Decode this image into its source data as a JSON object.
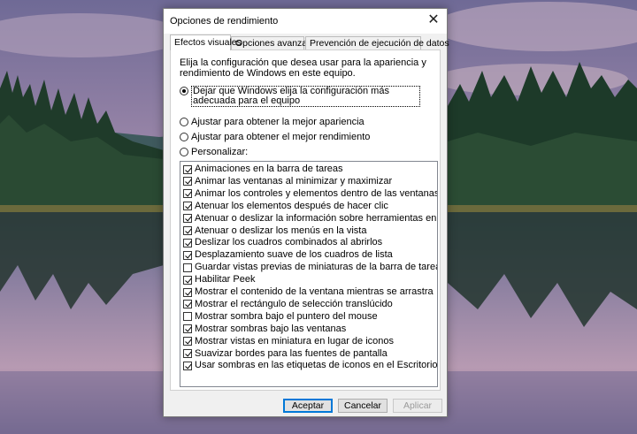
{
  "dialog": {
    "title": "Opciones de rendimiento",
    "close_glyph": "✕",
    "tabs": [
      {
        "label": "Efectos visuales",
        "active": true
      },
      {
        "label": "Opciones avanzadas",
        "active": false
      },
      {
        "label": "Prevención de ejecución de datos",
        "active": false
      }
    ],
    "description": "Elija la configuración que desea usar para la apariencia y rendimiento de Windows en este equipo.",
    "radios": {
      "default": {
        "label": "Dejar que Windows elija la configuración más adecuada para el equipo",
        "checked": true
      },
      "best_appearance": {
        "label": "Ajustar para obtener la mejor apariencia",
        "checked": false
      },
      "best_performance": {
        "label": "Ajustar para obtener el mejor rendimiento",
        "checked": false
      },
      "custom": {
        "label": "Personalizar:",
        "checked": false
      }
    },
    "effects": [
      {
        "label": "Animaciones en la barra de tareas",
        "checked": true
      },
      {
        "label": "Animar las ventanas al minimizar y maximizar",
        "checked": true
      },
      {
        "label": "Animar los controles y elementos dentro de las ventanas",
        "checked": true
      },
      {
        "label": "Atenuar los elementos después de hacer clic",
        "checked": true
      },
      {
        "label": "Atenuar o deslizar la información sobre herramientas en la vista",
        "checked": true
      },
      {
        "label": "Atenuar o deslizar los menús en la vista",
        "checked": true
      },
      {
        "label": "Deslizar los cuadros combinados al abrirlos",
        "checked": true
      },
      {
        "label": "Desplazamiento suave de los cuadros de lista",
        "checked": true
      },
      {
        "label": "Guardar vistas previas de miniaturas de la barra de tareas",
        "checked": false
      },
      {
        "label": "Habilitar Peek",
        "checked": true
      },
      {
        "label": "Mostrar el contenido de la ventana mientras se arrastra",
        "checked": true
      },
      {
        "label": "Mostrar el rectángulo de selección translúcido",
        "checked": true
      },
      {
        "label": "Mostrar sombra bajo el puntero del mouse",
        "checked": false
      },
      {
        "label": "Mostrar sombras bajo las ventanas",
        "checked": true
      },
      {
        "label": "Mostrar vistas en miniatura en lugar de iconos",
        "checked": true
      },
      {
        "label": "Suavizar bordes para las fuentes de pantalla",
        "checked": true
      },
      {
        "label": "Usar sombras en las etiquetas de iconos en el Escritorio",
        "checked": true
      }
    ],
    "buttons": {
      "ok": "Aceptar",
      "cancel": "Cancelar",
      "apply": "Aplicar"
    }
  },
  "colors": {
    "accent": "#0078d7",
    "dialog_bg": "#f0f0f0",
    "panel_bg": "#ffffff"
  }
}
